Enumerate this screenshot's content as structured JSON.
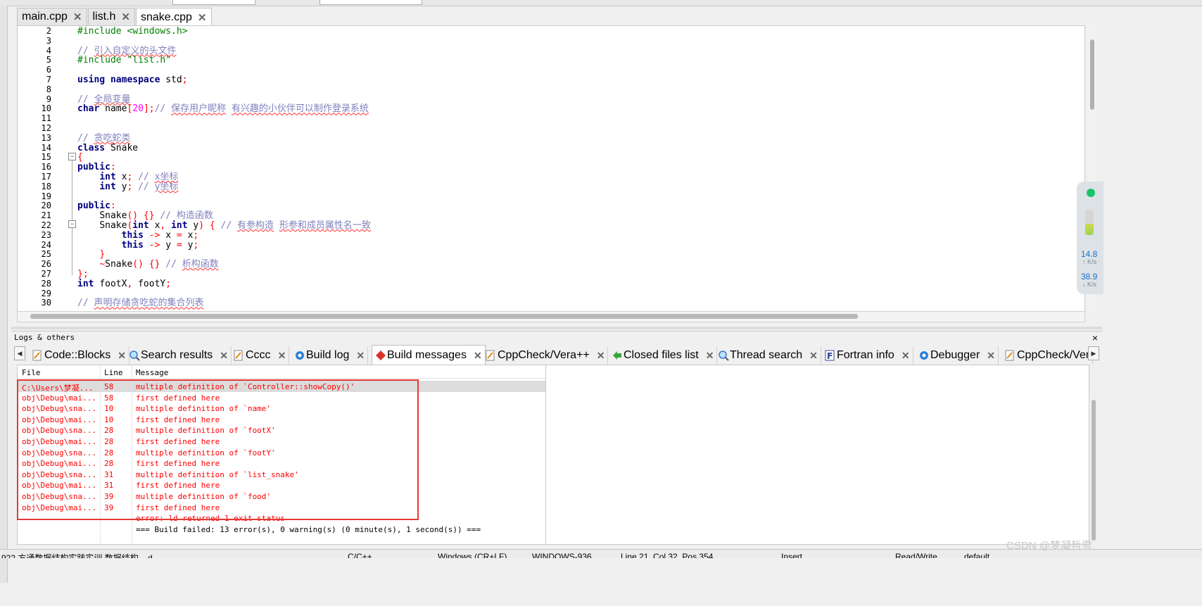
{
  "editor_tabs": [
    {
      "label": "main.cpp"
    },
    {
      "label": "list.h"
    },
    {
      "label": "snake.cpp"
    }
  ],
  "code": {
    "line_numbers": [
      "2",
      "3",
      "4",
      "5",
      "6",
      "7",
      "8",
      "9",
      "10",
      "11",
      "12",
      "13",
      "14",
      "15",
      "16",
      "17",
      "18",
      "19",
      "20",
      "21",
      "22",
      "23",
      "24",
      "25",
      "26",
      "27",
      "28",
      "29",
      "30"
    ]
  },
  "network_widget": {
    "upload_value": "14.8",
    "upload_unit": "K/s",
    "download_value": "38.9",
    "download_unit": "K/s"
  },
  "logs_panel": {
    "title": "Logs & others",
    "close": "×",
    "tabs": [
      {
        "label": "Code::Blocks",
        "icon": "page-icon"
      },
      {
        "label": "Search results",
        "icon": "search-icon"
      },
      {
        "label": "Cccc",
        "icon": "page-icon"
      },
      {
        "label": "Build log",
        "icon": "gear-icon"
      },
      {
        "label": "Build messages",
        "icon": "diamond-icon"
      },
      {
        "label": "CppCheck/Vera++",
        "icon": "page-icon"
      },
      {
        "label": "Closed files list",
        "icon": "arrow-icon"
      },
      {
        "label": "Thread search",
        "icon": "search-icon"
      },
      {
        "label": "Fortran info",
        "icon": "f-icon"
      },
      {
        "label": "Debugger",
        "icon": "gear-icon"
      },
      {
        "label": "CppCheck/Vera",
        "icon": "page-icon"
      }
    ],
    "columns": {
      "file": "File",
      "line": "Line",
      "message": "Message"
    },
    "rows": [
      {
        "file": "C:\\Users\\梦凝...",
        "line": "58",
        "message": "multiple definition of `Controller::showCopy()'"
      },
      {
        "file": "obj\\Debug\\mai...",
        "line": "58",
        "message": "first defined here"
      },
      {
        "file": "obj\\Debug\\sna...",
        "line": "10",
        "message": "multiple definition of `name'"
      },
      {
        "file": "obj\\Debug\\mai...",
        "line": "10",
        "message": "first defined here"
      },
      {
        "file": "obj\\Debug\\sna...",
        "line": "28",
        "message": "multiple definition of `footX'"
      },
      {
        "file": "obj\\Debug\\mai...",
        "line": "28",
        "message": "first defined here"
      },
      {
        "file": "obj\\Debug\\sna...",
        "line": "28",
        "message": "multiple definition of `footY'"
      },
      {
        "file": "obj\\Debug\\mai...",
        "line": "28",
        "message": "first defined here"
      },
      {
        "file": "obj\\Debug\\sna...",
        "line": "31",
        "message": "multiple definition of `list_snake'"
      },
      {
        "file": "obj\\Debug\\mai...",
        "line": "31",
        "message": "first defined here"
      },
      {
        "file": "obj\\Debug\\sna...",
        "line": "39",
        "message": "multiple definition of `food'"
      },
      {
        "file": "obj\\Debug\\mai...",
        "line": "39",
        "message": "first defined here"
      },
      {
        "file": "",
        "line": "",
        "message": "error: ld returned 1 exit status"
      },
      {
        "file": "",
        "line": "",
        "message": "=== Build failed: 13 error(s), 0 warning(s) (0 minute(s), 1 second(s)) ==="
      }
    ]
  },
  "status_bar": {
    "left": "922 方通数据结构实践实训 数据结构 ...d",
    "encoding_box": "C/C++",
    "eol": "Windows (CR+LF)",
    "charset": "WINDOWS-936",
    "position": "Line 21, Col 32, Pos 354",
    "mode": "Insert",
    "access": "Read/Write",
    "profile": "default"
  },
  "watermark": "CSDN @梦凝哲雪"
}
